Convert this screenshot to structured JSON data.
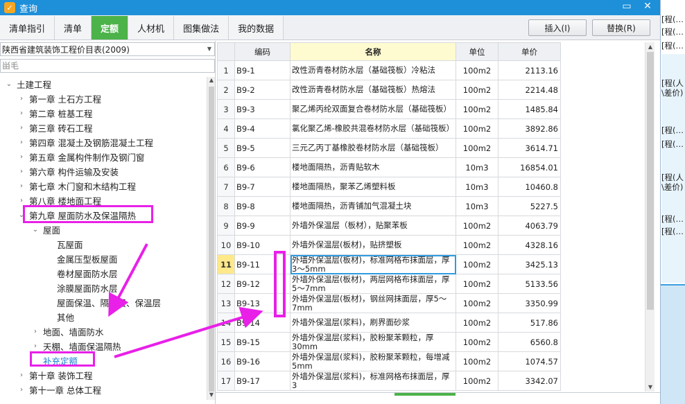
{
  "window": {
    "title": "查询",
    "minimize_glyph": "▭",
    "close_glyph": "✕"
  },
  "tabs": [
    {
      "label": "清单指引",
      "active": false
    },
    {
      "label": "清单",
      "active": false
    },
    {
      "label": "定额",
      "active": true
    },
    {
      "label": "人材机",
      "active": false
    },
    {
      "label": "图集做法",
      "active": false
    },
    {
      "label": "我的数据",
      "active": false
    }
  ],
  "actions": {
    "insert": "插入(I)",
    "replace": "替换(R)"
  },
  "library": {
    "selected": "陕西省建筑装饰工程价目表(2009)"
  },
  "search": {
    "value": "",
    "placeholder": "畄毛"
  },
  "tree": [
    {
      "label": "土建工程",
      "level": 0,
      "state": "open"
    },
    {
      "label": "第一章  土石方工程",
      "level": 1,
      "state": "closed"
    },
    {
      "label": "第二章  桩基工程",
      "level": 1,
      "state": "closed"
    },
    {
      "label": "第三章  砖石工程",
      "level": 1,
      "state": "closed"
    },
    {
      "label": "第四章  混凝土及钢筋混凝土工程",
      "level": 1,
      "state": "closed"
    },
    {
      "label": "第五章  金属构件制作及钢门窗",
      "level": 1,
      "state": "closed"
    },
    {
      "label": "第六章  构件运输及安装",
      "level": 1,
      "state": "closed"
    },
    {
      "label": "第七章  木门窗和木结构工程",
      "level": 1,
      "state": "closed"
    },
    {
      "label": "第八章  楼地面工程",
      "level": 1,
      "state": "closed"
    },
    {
      "label": "第九章  屋面防水及保温隔热",
      "level": 1,
      "state": "open"
    },
    {
      "label": "屋面",
      "level": 2,
      "state": "open"
    },
    {
      "label": "瓦屋面",
      "level": 3,
      "state": "leaf"
    },
    {
      "label": "金属压型板屋面",
      "level": 3,
      "state": "leaf"
    },
    {
      "label": "卷材屋面防水层",
      "level": 3,
      "state": "leaf"
    },
    {
      "label": "涂膜屋面防水层",
      "level": 3,
      "state": "leaf"
    },
    {
      "label": "屋面保温、隔热层、保温层",
      "level": 3,
      "state": "leaf"
    },
    {
      "label": "其他",
      "level": 3,
      "state": "leaf"
    },
    {
      "label": "地面、墙面防水",
      "level": 2,
      "state": "closed"
    },
    {
      "label": "天棚、墙面保温隔热",
      "level": 2,
      "state": "closed"
    },
    {
      "label": "补充定额",
      "level": 2,
      "state": "link"
    },
    {
      "label": "第十章  装饰工程",
      "level": 1,
      "state": "closed"
    },
    {
      "label": "第十一章  总体工程",
      "level": 1,
      "state": "closed"
    }
  ],
  "table": {
    "columns": [
      "",
      "编码",
      "名称",
      "单位",
      "单价"
    ],
    "rows": [
      {
        "idx": "1",
        "code": "B9-1",
        "name": "改性沥青卷材防水层（基础筏板）冷粘法",
        "unit": "100m2",
        "price": "2113.16"
      },
      {
        "idx": "2",
        "code": "B9-2",
        "name": "改性沥青卷材防水层（基础筏板）热熔法",
        "unit": "100m2",
        "price": "2214.48"
      },
      {
        "idx": "3",
        "code": "B9-3",
        "name": "聚乙烯丙纶双面复合卷材防水层（基础筏板）",
        "unit": "100m2",
        "price": "1485.84"
      },
      {
        "idx": "4",
        "code": "B9-4",
        "name": "氯化聚乙烯-橡胶共混卷材防水层（基础筏板）",
        "unit": "100m2",
        "price": "3892.86"
      },
      {
        "idx": "5",
        "code": "B9-5",
        "name": "三元乙丙丁基橡胶卷材防水层（基础筏板）",
        "unit": "100m2",
        "price": "3614.71"
      },
      {
        "idx": "6",
        "code": "B9-6",
        "name": "楼地面隔热，沥青贴软木",
        "unit": "10m3",
        "price": "16854.01"
      },
      {
        "idx": "7",
        "code": "B9-7",
        "name": "楼地面隔热，聚苯乙烯塑料板",
        "unit": "10m3",
        "price": "10460.8"
      },
      {
        "idx": "8",
        "code": "B9-8",
        "name": "楼地面隔热，沥青铺加气混凝土块",
        "unit": "10m3",
        "price": "5227.5"
      },
      {
        "idx": "9",
        "code": "B9-9",
        "name": "外墙外保温层（板材），贴聚苯板",
        "unit": "100m2",
        "price": "4063.79"
      },
      {
        "idx": "10",
        "code": "B9-10",
        "name": "外墙外保温层(板材)，贴挤塑板",
        "unit": "100m2",
        "price": "4328.16"
      },
      {
        "idx": "11",
        "code": "B9-11",
        "name": "外墙外保温层(板材)，标准网格布抹面层，厚3～5mm",
        "unit": "100m2",
        "price": "3425.13",
        "selected": true
      },
      {
        "idx": "12",
        "code": "B9-12",
        "name": "外墙外保温层(板材)，两层网格布抹面层，厚5～7mm",
        "unit": "100m2",
        "price": "5133.56"
      },
      {
        "idx": "13",
        "code": "B9-13",
        "name": "外墙外保温层(板材)，钢丝网抹面层，厚5～7mm",
        "unit": "100m2",
        "price": "3350.99"
      },
      {
        "idx": "14",
        "code": "B9-14",
        "name": "外墙外保温层(浆料)，刷界面砂浆",
        "unit": "100m2",
        "price": "517.86"
      },
      {
        "idx": "15",
        "code": "B9-15",
        "name": "外墙外保温层(浆料)，胶粉聚苯颗粒，厚30mm",
        "unit": "100m2",
        "price": "6560.8"
      },
      {
        "idx": "16",
        "code": "B9-16",
        "name": "外墙外保温层(浆料)，胶粉聚苯颗粒，每增减5mm",
        "unit": "100m2",
        "price": "1074.57"
      },
      {
        "idx": "17",
        "code": "B9-17",
        "name": "外墙外保温层(浆料)，标准网格布抹面层，厚3",
        "unit": "100m2",
        "price": "3342.07"
      }
    ]
  },
  "background_app": {
    "items": [
      "[程(…",
      "[程(…",
      "[程(…",
      "[程(人",
      "\\差价)",
      "[程(…",
      "[程(…",
      "[程(人",
      "\\差价)",
      "[程(…",
      "[程(…"
    ]
  },
  "colors": {
    "titlebar": "#1e8fd9",
    "active_tab": "#4cb24a",
    "annotation": "#e820e8",
    "link": "#1a7fd4"
  }
}
